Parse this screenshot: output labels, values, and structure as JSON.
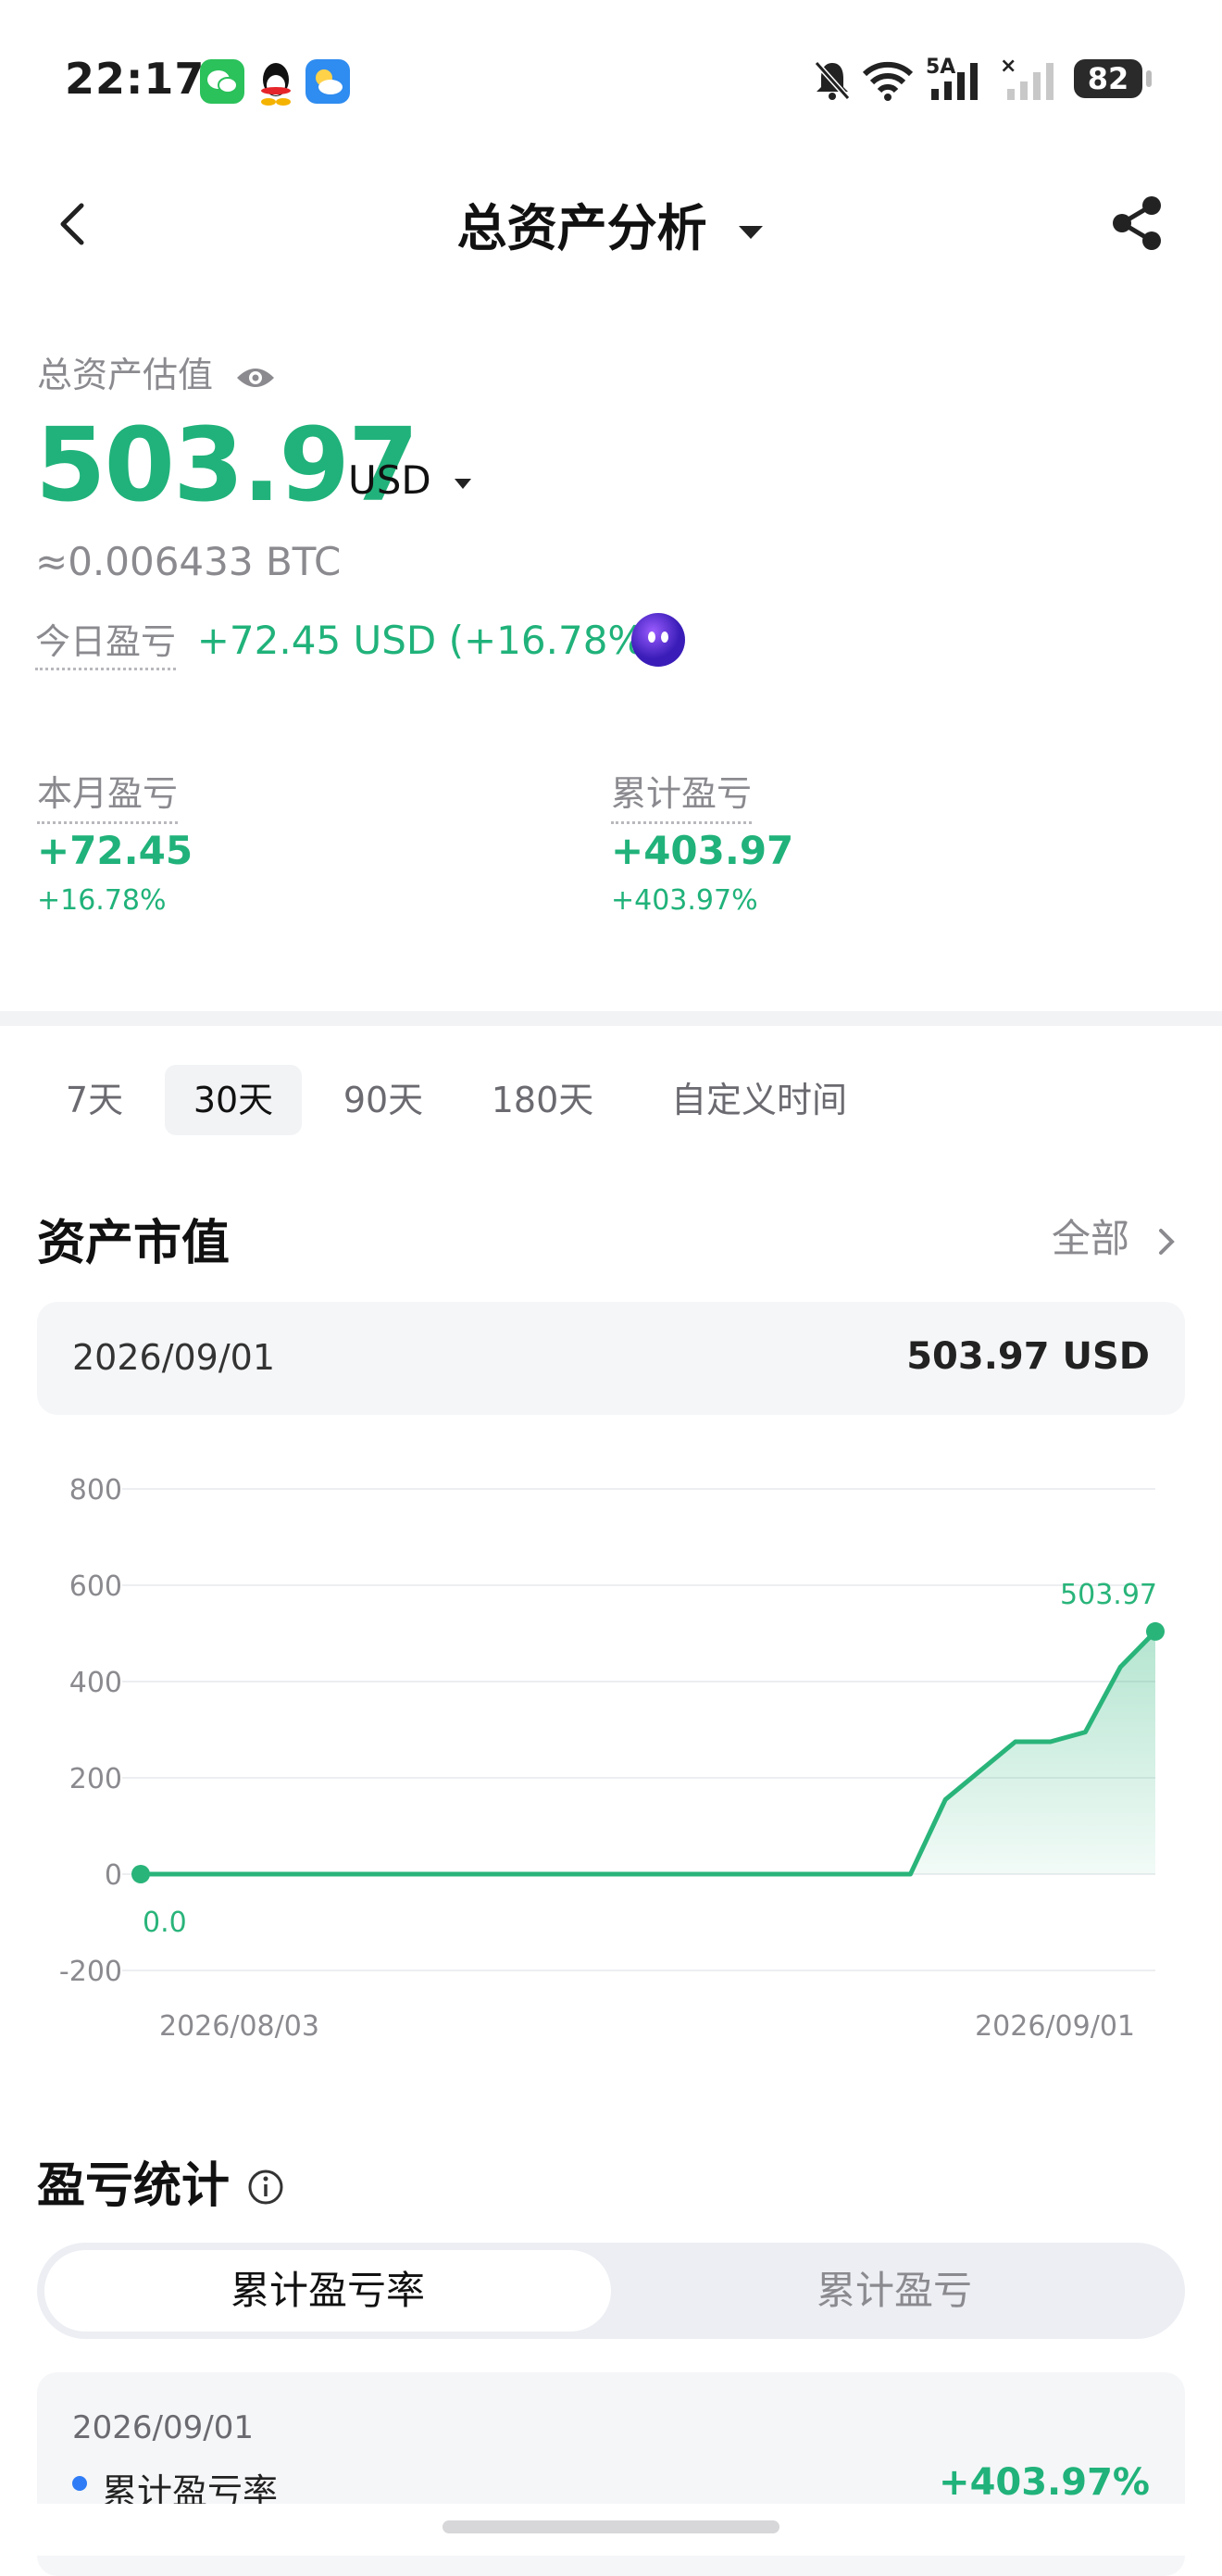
{
  "status_bar": {
    "time": "22:17",
    "network": "5A",
    "battery": "82"
  },
  "header": {
    "title": "总资产分析"
  },
  "summary": {
    "label": "总资产估值",
    "value": "503.97",
    "unit": "USD",
    "btc": "≈0.006433 BTC",
    "today_label": "今日盈亏",
    "today_value": "+72.45 USD (+16.78%)",
    "month_label": "本月盈亏",
    "month_value": "+72.45",
    "month_pct": "+16.78%",
    "total_label": "累计盈亏",
    "total_value": "+403.97",
    "total_pct": "+403.97%"
  },
  "tabs": [
    {
      "label": "7天",
      "active": false
    },
    {
      "label": "30天",
      "active": true
    },
    {
      "label": "90天",
      "active": false
    },
    {
      "label": "180天",
      "active": false
    },
    {
      "label": "自定义时间",
      "active": false
    }
  ],
  "market": {
    "title": "资产市值",
    "all_label": "全部",
    "date": "2026/09/01",
    "value": "503.97 USD"
  },
  "chart_data": {
    "type": "area",
    "ylim": [
      -200,
      800
    ],
    "y_ticks": [
      "800",
      "600",
      "400",
      "200",
      "0",
      "-200"
    ],
    "x_tick_labels": [
      "2026/08/03",
      "2026/09/01"
    ],
    "start_label": "0.0",
    "end_label": "503.97",
    "values": [
      0,
      0,
      0,
      0,
      0,
      0,
      0,
      0,
      0,
      0,
      0,
      0,
      0,
      0,
      0,
      0,
      0,
      0,
      0,
      0,
      0,
      0,
      0,
      155,
      215,
      275,
      275,
      295,
      430,
      503.97
    ],
    "colors": {
      "line": "#29b47a",
      "fill": "#29b47a"
    }
  },
  "pnl": {
    "title": "盈亏统计",
    "seg_rate": "累计盈亏率",
    "seg_amount": "累计盈亏",
    "date": "2026/09/01",
    "legend_label": "累计盈亏率",
    "legend_value": "+403.97%"
  },
  "colors": {
    "accent": "#20b27a",
    "legend_dot": "#2f7cf6"
  }
}
